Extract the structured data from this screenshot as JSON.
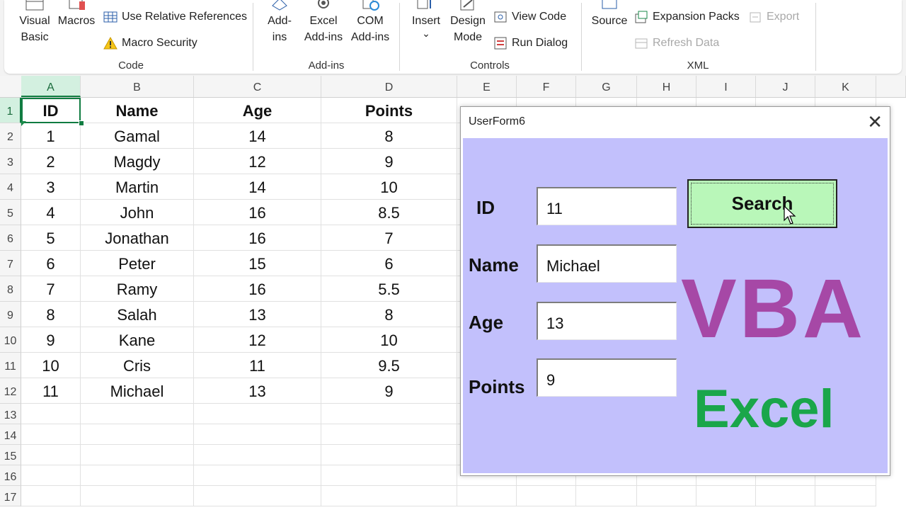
{
  "ribbon": {
    "code": {
      "visual_basic": "Visual\nBasic",
      "macros": "Macros",
      "use_relative": "Use Relative References",
      "macro_security": "Macro Security",
      "label": "Code"
    },
    "addins": {
      "addins": "Add-\nins",
      "excel_addins": "Excel\nAdd-ins",
      "com_addins": "COM\nAdd-ins",
      "label": "Add-ins"
    },
    "controls": {
      "insert": "Insert",
      "insert_arrow": "⌄",
      "design_mode": "Design\nMode",
      "view_code": "View Code",
      "run_dialog": "Run Dialog",
      "label": "Controls"
    },
    "xml": {
      "source": "Source",
      "expansion_packs": "Expansion Packs",
      "export": "Export",
      "refresh_data": "Refresh Data",
      "label": "XML"
    }
  },
  "sheet": {
    "columns": [
      "A",
      "B",
      "C",
      "D",
      "E",
      "F",
      "G",
      "H",
      "I",
      "J",
      "K"
    ],
    "row_numbers": [
      "1",
      "2",
      "3",
      "4",
      "5",
      "6",
      "7",
      "8",
      "9",
      "10",
      "11",
      "12",
      "13",
      "14",
      "15",
      "16",
      "17"
    ],
    "headers": [
      "ID",
      "Name",
      "Age",
      "Points"
    ],
    "rows": [
      [
        "1",
        "Gamal",
        "14",
        "8"
      ],
      [
        "2",
        "Magdy",
        "12",
        "9"
      ],
      [
        "3",
        "Martin",
        "14",
        "10"
      ],
      [
        "4",
        "John",
        "16",
        "8.5"
      ],
      [
        "5",
        "Jonathan",
        "16",
        "7"
      ],
      [
        "6",
        "Peter",
        "15",
        "6"
      ],
      [
        "7",
        "Ramy",
        "16",
        "5.5"
      ],
      [
        "8",
        "Salah",
        "13",
        "8"
      ],
      [
        "9",
        "Kane",
        "12",
        "10"
      ],
      [
        "10",
        "Cris",
        "11",
        "9.5"
      ],
      [
        "11",
        "Michael",
        "13",
        "9"
      ]
    ]
  },
  "userform": {
    "title": "UserForm6",
    "close": "✕",
    "id_label": "ID",
    "id_value": "11",
    "name_label": "Name",
    "name_value": "Michael",
    "age_label": "Age",
    "age_value": "13",
    "points_label": "Points",
    "points_value": "9",
    "search_label": "Search"
  },
  "overlay": {
    "vba": "VBA",
    "excel": "Excel"
  },
  "colors": {
    "form_bg": "#c2c0fc",
    "search_bg": "#b9f7b9",
    "vba": "#a648a6",
    "excel": "#1aa64a",
    "excel_green": "#107c41"
  }
}
